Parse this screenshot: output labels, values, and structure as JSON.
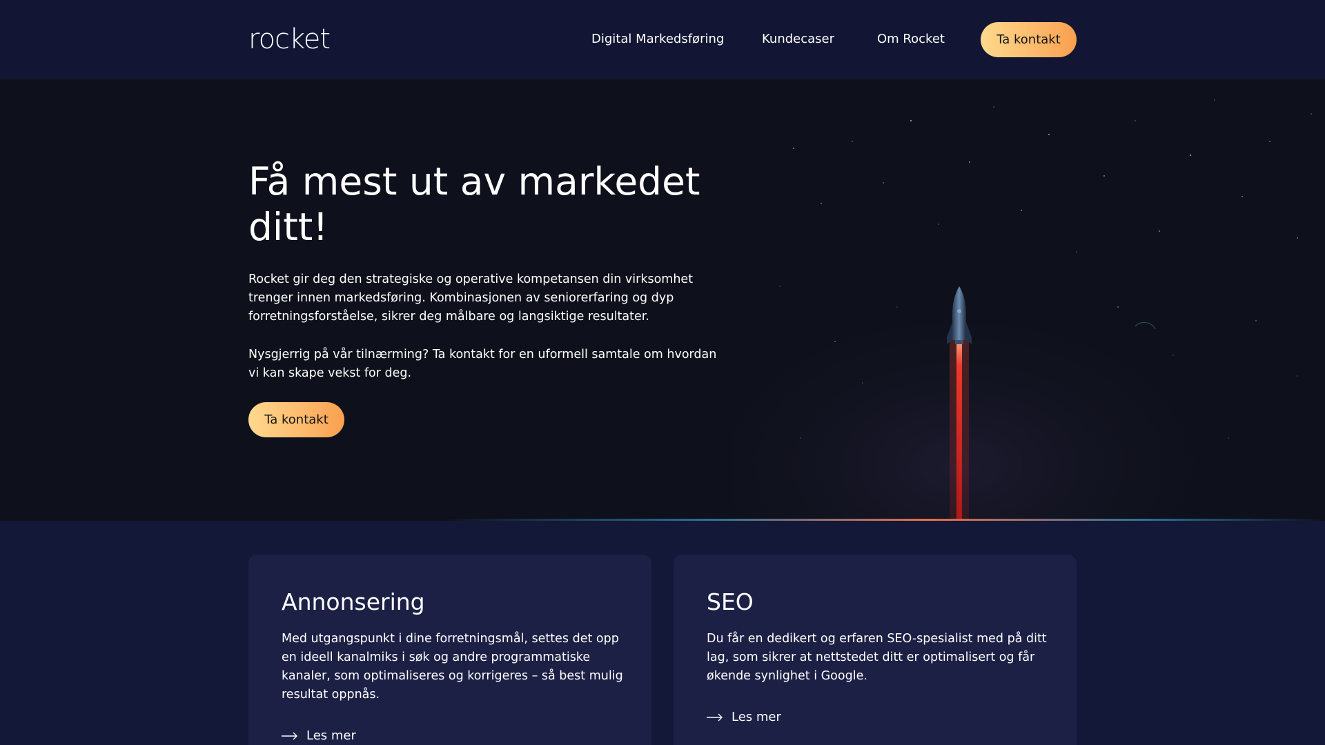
{
  "header": {
    "logo": "rocket",
    "nav": [
      "Digital Markedsføring",
      "Kundecaser",
      "Om Rocket"
    ],
    "cta": "Ta kontakt"
  },
  "hero": {
    "title": "Få mest ut av markedet ditt!",
    "paragraph1": "Rocket gir deg den strategiske og operative kompetansen din virksomhet trenger innen markedsføring. Kombinasjonen av seniorerfaring og dyp forretningsforståelse, sikrer deg målbare og langsiktige resultater.",
    "paragraph2": "Nysgjerrig på vår tilnærming? Ta kontakt for en uformell samtale om hvordan vi kan skape vekst for deg.",
    "cta": "Ta kontakt"
  },
  "cards": [
    {
      "title": "Annonsering",
      "body": "Med utgangspunkt i dine forretningsmål, settes det opp en ideell kanalmiks i søk og andre programmatiske kanaler, som optimaliseres og korrigeres – så best mulig resultat oppnås.",
      "link": "Les mer"
    },
    {
      "title": "SEO",
      "body": "Du får en dedikert og erfaren SEO-spesialist med på ditt lag, som sikrer at nettstedet ditt er optimalisert og får økende synlighet i Google.",
      "link": "Les mer"
    }
  ],
  "colors": {
    "header_bg": "#121634",
    "hero_bg": "#0e111b",
    "section_bg": "#131838",
    "card_bg": "#1c2045",
    "cta_gradient_start": "#ffd98e",
    "cta_gradient_end": "#f9a04f",
    "rocket_trail": "#ff3b2a"
  },
  "icons": [
    "rocket-illustration",
    "arrow-right-icon"
  ]
}
